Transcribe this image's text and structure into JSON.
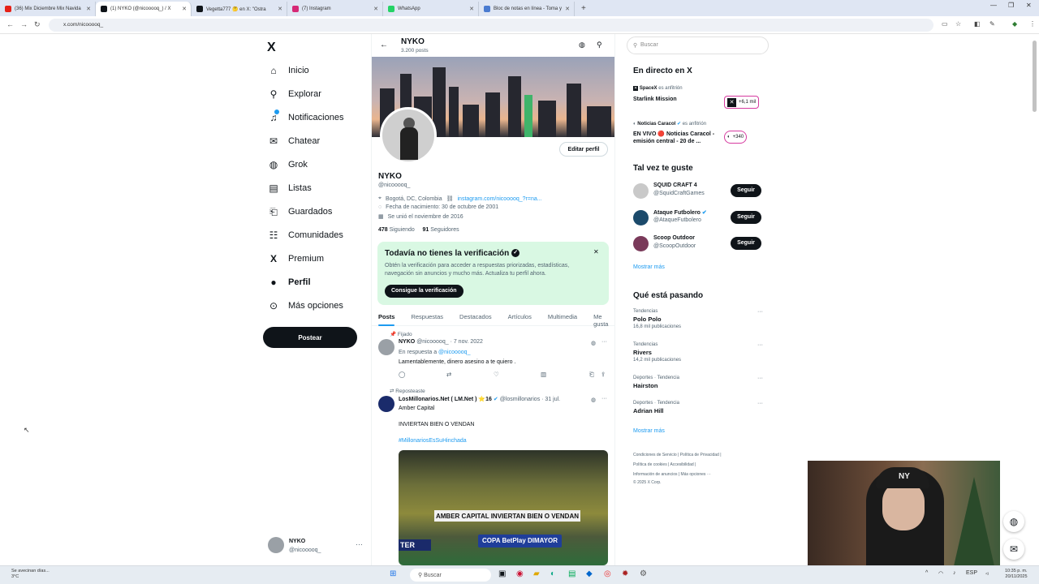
{
  "browser": {
    "tabs": [
      {
        "title": "(36) Mix Diciembre Mix Navida",
        "color": "#e62117"
      },
      {
        "title": "(1) NYKO (@nicooooq_) / X",
        "color": "#0f1419"
      },
      {
        "title": "Vegetta777 🤔 en X: \"Ostra",
        "color": "#0f1419"
      },
      {
        "title": "(7) Instagram",
        "color": "#d62976"
      },
      {
        "title": "WhatsApp",
        "color": "#25d366"
      },
      {
        "title": "Bloc de notas en línea - Toma y",
        "color": "#4a7bd0"
      }
    ],
    "url": "x.com/nicooooq_"
  },
  "sidebar": {
    "logo": "X",
    "items": [
      {
        "label": "Inicio",
        "icon": "⌂",
        "icon_name": "home-icon"
      },
      {
        "label": "Explorar",
        "icon": "⚲",
        "icon_name": "search-icon"
      },
      {
        "label": "Notificaciones",
        "icon": "♫",
        "icon_name": "bell-icon"
      },
      {
        "label": "Chatear",
        "icon": "✉",
        "icon_name": "mail-icon"
      },
      {
        "label": "Grok",
        "icon": "◍",
        "icon_name": "grok-icon"
      },
      {
        "label": "Listas",
        "icon": "▤",
        "icon_name": "list-icon"
      },
      {
        "label": "Guardados",
        "icon": "⎗",
        "icon_name": "bookmark-icon"
      },
      {
        "label": "Comunidades",
        "icon": "☷",
        "icon_name": "communities-icon"
      },
      {
        "label": "Premium",
        "icon": "X",
        "icon_name": "x-premium-icon"
      },
      {
        "label": "Perfil",
        "icon": "●",
        "icon_name": "profile-icon"
      },
      {
        "label": "Más opciones",
        "icon": "⊙",
        "icon_name": "more-options-icon"
      }
    ],
    "post_button": "Postear",
    "account": {
      "name": "NYKO",
      "handle": "@nicooooq_",
      "more": "···"
    }
  },
  "profile": {
    "header_name": "NYKO",
    "post_count": "3.200 posts",
    "name": "NYKO",
    "handle": "@nicooooq_",
    "edit_button": "Editar perfil",
    "location": "Bogotá, DC, Colombia",
    "link": "instagram.com/nicooooq_?r=na...",
    "birthday": "Fecha de nacimiento: 30 de octubre de 2001",
    "joined": "Se unió el noviembre de 2016",
    "following_count": "478",
    "following_label": "Siguiendo",
    "followers_count": "91",
    "followers_label": "Seguidores"
  },
  "verification": {
    "title": "Todavía no tienes la verificación",
    "description": "Obtén la verificación para acceder a respuestas priorizadas, estadísticas, navegación sin anuncios y mucho más. Actualiza tu perfil ahora.",
    "button": "Consigue la verificación",
    "close": "✕"
  },
  "profile_tabs": [
    "Posts",
    "Respuestas",
    "Destacados",
    "Artículos",
    "Multimedia",
    "Me gusta"
  ],
  "tweets": [
    {
      "context": "Fijado",
      "name": "NYKO",
      "handle": "@nicooooq_",
      "date": "· 7 nov. 2022",
      "reply_to_prefix": "En respuesta a",
      "reply_to": "@nicooooq_",
      "text": "Lamentablemente, dinero asesino a te quiero ."
    },
    {
      "context": "Reposteaste",
      "name": "LosMillonarios.Net ( LM.Net ) ⭐16",
      "handle": "@losmillonarios",
      "date": "· 31 jul.",
      "lines": [
        "Amber Capital",
        "INVIERTAN BIEN O VENDAN"
      ],
      "hashtag": "#MillonariosEsSuHinchada",
      "image_banner": "AMBER CAPITAL  INVIERTAN BIEN O VENDAN",
      "image_ad": "COPA BetPlay DIMAYOR",
      "image_ad2": "TER"
    }
  ],
  "right": {
    "search_placeholder": "Buscar",
    "live_title": "En directo en X",
    "spaces": [
      {
        "host": "SpaceX",
        "host_suffix": "es anfitrión",
        "title": "Starlink Mission",
        "count": "+6,1 mil"
      },
      {
        "host": "Noticias Caracol",
        "host_suffix": "es anfitrión",
        "title": "EN VIVO 🔴 Noticias Caracol - emisión central - 20 de ...",
        "count": "+340"
      }
    ],
    "who_title": "Tal vez te guste",
    "who": [
      {
        "name": "SQUID CRAFT 4",
        "handle": "@SquidCraftGames",
        "button": "Seguir",
        "color": "#c9c9c9"
      },
      {
        "name": "Ataque Futbolero",
        "handle": "@AtaqueFutbolero",
        "button": "Seguir",
        "color": "#1b4a6b"
      },
      {
        "name": "Scoop Outdoor",
        "handle": "@ScoopOutdoor",
        "button": "Seguir",
        "color": "#7a3a5a"
      }
    ],
    "who_more": "Mostrar más",
    "trends_title": "Qué está pasando",
    "trends": [
      {
        "category": "Tendencias",
        "name": "Polo Polo",
        "posts": "16,8 mil publicaciones"
      },
      {
        "category": "Tendencias",
        "name": "Rivers",
        "posts": "14,2 mil publicaciones"
      },
      {
        "category": "Deportes · Tendencia",
        "name": "Hairston",
        "posts": ""
      },
      {
        "category": "Deportes · Tendencia",
        "name": "Adrian Hill",
        "posts": ""
      }
    ],
    "trends_more": "Mostrar más",
    "footer": [
      "Condiciones de Servicio  |  Política de Privacidad  |",
      "Política de cookies  |  Accesibilidad  |",
      "Información de anuncios  |  Más opciones ···",
      "© 2025 X Corp."
    ]
  },
  "taskbar": {
    "weather_line1": "Se avecinan días...",
    "weather_line2": "3°C",
    "search": "Buscar",
    "lang": "ESP",
    "time": "10:35 p. m.",
    "date": "20/11/2025"
  },
  "webcam": {
    "cap_logo": "NY"
  }
}
